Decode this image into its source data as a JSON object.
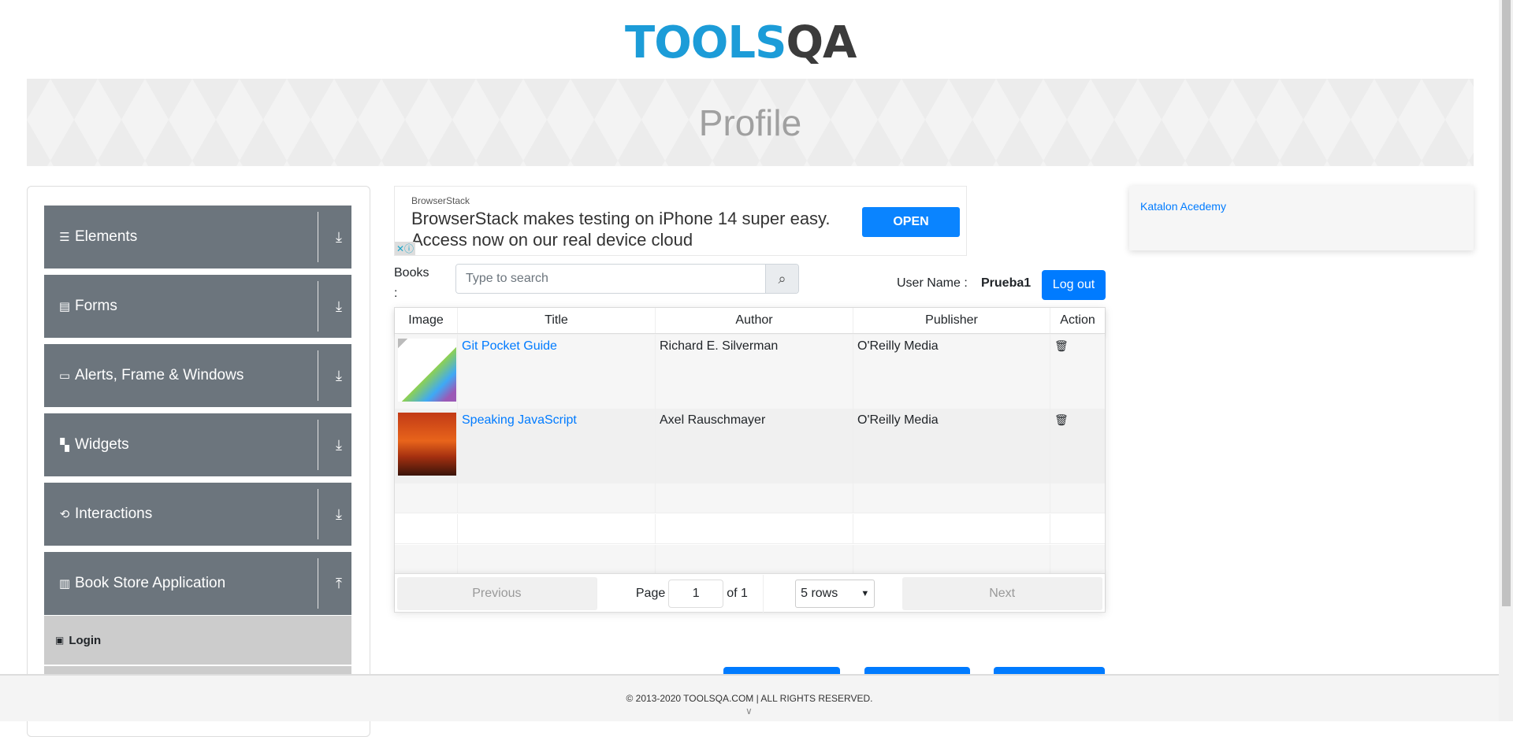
{
  "logo": {
    "part1": "TOOLS",
    "part2": "QA"
  },
  "header": {
    "title": "Profile"
  },
  "sidebar": {
    "groups": [
      {
        "label": "Elements",
        "icon": "hamburger-icon"
      },
      {
        "label": "Forms",
        "icon": "form-icon"
      },
      {
        "label": "Alerts, Frame & Windows",
        "icon": "window-icon"
      },
      {
        "label": "Widgets",
        "icon": "widgets-icon"
      },
      {
        "label": "Interactions",
        "icon": "interactions-icon"
      },
      {
        "label": "Book Store Application",
        "icon": "books-icon"
      }
    ],
    "active_item": "Login"
  },
  "ad": {
    "source": "BrowserStack",
    "line1": "BrowserStack makes testing on iPhone 14 super easy.",
    "line2": "Access now on our real device cloud",
    "cta": "OPEN"
  },
  "books": {
    "label": "Books :",
    "search_placeholder": "Type to search"
  },
  "user": {
    "label": "User Name :",
    "value": "Prueba1",
    "logout": "Log out"
  },
  "table": {
    "headers": [
      "Image",
      "Title",
      "Author",
      "Publisher",
      "Action"
    ],
    "rows": [
      {
        "title": "Git Pocket Guide",
        "author": "Richard E. Silverman",
        "publisher": "O'Reilly Media"
      },
      {
        "title": "Speaking JavaScript",
        "author": "Axel Rauschmayer",
        "publisher": "O'Reilly Media"
      }
    ]
  },
  "pagination": {
    "previous": "Previous",
    "page_label": "Page",
    "page": "1",
    "of": "of 1",
    "rows": "5 rows",
    "next": "Next"
  },
  "right_ad": {
    "alt": "Katalon Acedemy"
  },
  "footer": {
    "text": "© 2013-2020 TOOLSQA.COM | ALL RIGHTS RESERVED."
  }
}
